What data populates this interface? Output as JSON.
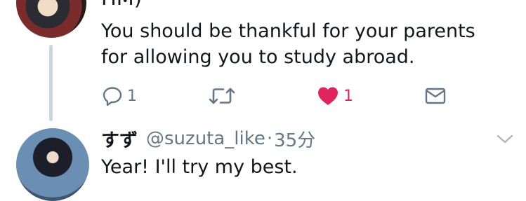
{
  "tweet1": {
    "author_fragment": "HM)",
    "text_line1": "You should be thankful for your parents",
    "text_line2": "for allowing you to study abroad.",
    "reply_count": "1",
    "retweet_count": "",
    "like_count": "1",
    "liked": true
  },
  "tweet2": {
    "display_name": "すず",
    "handle": "@suzuta_like",
    "separator": "·",
    "time": "35分",
    "text": "Year! I'll try my best."
  },
  "icons": {
    "reply": "reply-icon",
    "retweet": "retweet-icon",
    "like": "heart-icon",
    "dm": "envelope-icon",
    "more": "chevron-down-icon"
  },
  "colors": {
    "text": "#14171a",
    "muted": "#657786",
    "like": "#e0245e",
    "thread_line": "#ccd6dd"
  }
}
